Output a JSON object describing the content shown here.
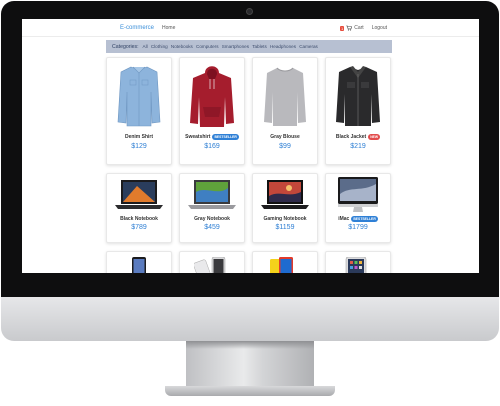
{
  "navbar": {
    "brand": "E-commerce",
    "home": "Home",
    "cart_count": "1",
    "cart_label": "Cart",
    "logout": "Logout"
  },
  "categories": {
    "title": "Categories:",
    "items": [
      "All",
      "Clothing",
      "Notebooks",
      "Computers",
      "Smartphones",
      "Tablets",
      "Headphones",
      "Cameras"
    ]
  },
  "products": [
    {
      "name": "Denim Shirt",
      "price": "$129",
      "badge": "",
      "icon": "denim-shirt-image"
    },
    {
      "name": "Sweatshirt",
      "price": "$169",
      "badge": "BESTSELLER",
      "icon": "red-hoodie-image"
    },
    {
      "name": "Gray Blouse",
      "price": "$99",
      "badge": "",
      "icon": "gray-sweater-image"
    },
    {
      "name": "Black Jacket",
      "price": "$219",
      "badge": "NEW",
      "icon": "black-jacket-image"
    },
    {
      "name": "Black Notebook",
      "price": "$789",
      "badge": "",
      "icon": "laptop-image"
    },
    {
      "name": "Gray Notebook",
      "price": "$459",
      "badge": "",
      "icon": "laptop-image"
    },
    {
      "name": "Gaming Notebook",
      "price": "$1159",
      "badge": "",
      "icon": "laptop-image"
    },
    {
      "name": "iMac",
      "price": "$1799",
      "badge": "BESTSELLER",
      "icon": "imac-image"
    }
  ],
  "partial_products": [
    {
      "icon": "smartphone-image"
    },
    {
      "icon": "smartphone-image"
    },
    {
      "icon": "smartphone-image"
    },
    {
      "icon": "tablet-image"
    }
  ],
  "colors": {
    "accent": "#2e7fd4",
    "category_bar": "#b7c0d2",
    "badge_bestseller": "#2f80d6",
    "badge_new": "#e24b4b"
  }
}
